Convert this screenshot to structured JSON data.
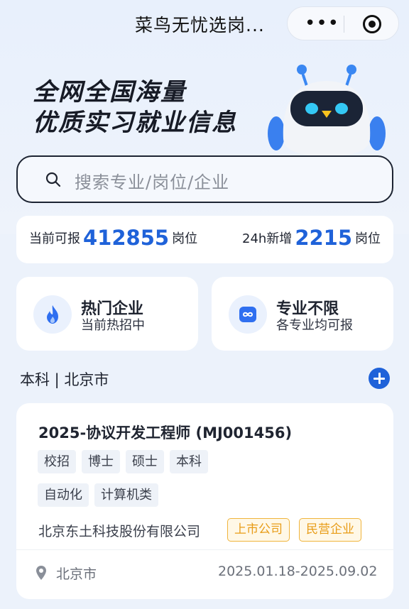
{
  "nav": {
    "title": "菜鸟无忧选岗...",
    "more_icon": "•••",
    "close_icon": "record-circle-icon"
  },
  "hero": {
    "line1": "全网全国海量",
    "line2": "优质实习就业信息",
    "mascot_icon": "robot-mascot-icon"
  },
  "search": {
    "placeholder": "搜索专业/岗位/企业",
    "icon": "search-icon"
  },
  "stats": {
    "current_label": "当前可报",
    "current_value": "412855",
    "current_unit": "岗位",
    "new_label": "24h新增",
    "new_value": "2215",
    "new_unit": "岗位"
  },
  "quick_cards": [
    {
      "title": "热门企业",
      "subtitle": "当前热招中",
      "icon": "fire-icon"
    },
    {
      "title": "专业不限",
      "subtitle": "各专业均可报",
      "icon": "infinity-icon"
    }
  ],
  "filter": {
    "label": "本科 | 北京市",
    "add_icon": "plus-circle-icon"
  },
  "job": {
    "title": "2025-协议开发工程师 (MJ001456)",
    "tags_row1": [
      "校招",
      "博士",
      "硕士",
      "本科"
    ],
    "tags_row2": [
      "自动化",
      "计算机类"
    ],
    "company": "北京东土科技股份有限公司",
    "company_tags": [
      "上市公司",
      "民营企业"
    ],
    "location": "北京市",
    "dates": "2025.01.18-2025.09.02"
  },
  "colors": {
    "accent": "#1f62d9",
    "tag_orange": "#e89c17",
    "background": "#ecf2fb"
  }
}
